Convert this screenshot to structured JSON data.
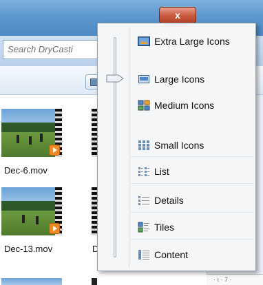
{
  "window": {
    "close_glyph": "x",
    "search_placeholder": "Search DryCasti"
  },
  "files": [
    {
      "name": "Dec-6.mov"
    },
    {
      "name": "Dec-13.mov"
    },
    {
      "name": "D"
    }
  ],
  "ruler_text": "· ı · 7 ·",
  "view_menu": {
    "slider_level_label": "Large Icons",
    "items": [
      {
        "label": "Extra Large Icons",
        "icon": "extra-large-icons-icon"
      },
      {
        "label": "Large Icons",
        "icon": "large-icons-icon"
      },
      {
        "label": "Medium Icons",
        "icon": "medium-icons-icon"
      },
      {
        "label": "Small Icons",
        "icon": "small-icons-icon"
      },
      {
        "label": "List",
        "icon": "list-icon"
      },
      {
        "label": "Details",
        "icon": "details-icon"
      },
      {
        "label": "Tiles",
        "icon": "tiles-icon"
      },
      {
        "label": "Content",
        "icon": "content-icon"
      }
    ]
  },
  "colors": {
    "accent": "#5d98cf",
    "close": "#c9593e",
    "play_badge": "#f08a24"
  }
}
